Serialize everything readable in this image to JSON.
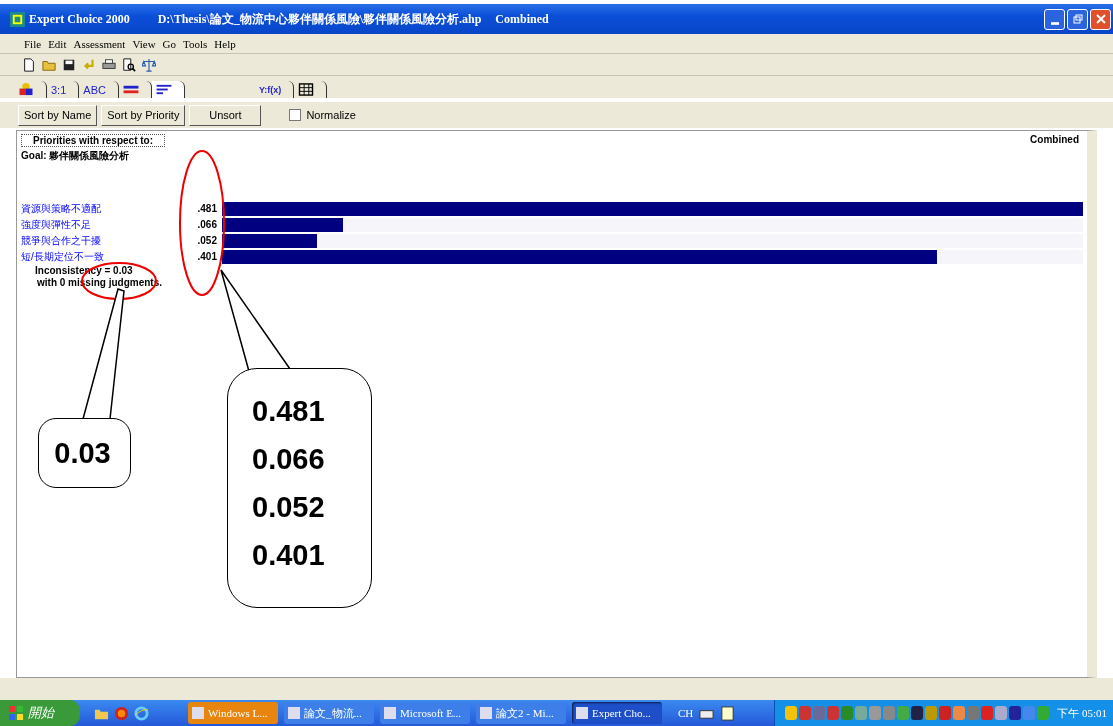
{
  "window": {
    "title": "Expert Choice 2000",
    "path": "D:\\Thesis\\論文_物流中心夥伴關係風險\\夥伴關係風險分析.ahp",
    "mode": "Combined"
  },
  "menu": [
    "File",
    "Edit",
    "Assessment",
    "View",
    "Go",
    "Tools",
    "Help"
  ],
  "tabs": [
    {
      "kind": "shapes",
      "selected": false
    },
    {
      "kind": "text",
      "label": "3:1",
      "selected": false
    },
    {
      "kind": "text",
      "label": "ABC",
      "selected": false
    },
    {
      "kind": "equal",
      "selected": false
    },
    {
      "kind": "sort",
      "selected": true
    },
    {
      "kind": "formula",
      "label": "Y:f(x)",
      "selected": false
    },
    {
      "kind": "grid",
      "selected": false
    }
  ],
  "buttons": [
    "Sort by Name",
    "Sort by Priority",
    "Unsort"
  ],
  "normalize": {
    "label": "Normalize",
    "checked": false
  },
  "header": {
    "caption": "Priorities with respect to:",
    "goal": "Goal: 夥伴關係風險分析",
    "right": "Combined"
  },
  "priorities": [
    {
      "name": "資源與策略不適配",
      "value": ".481",
      "level": 1.0
    },
    {
      "name": "強度與彈性不足",
      "value": ".066",
      "level": 0.14
    },
    {
      "name": "競爭與合作之干擾",
      "value": ".052",
      "level": 0.11
    },
    {
      "name": "短/長期定位不一致",
      "value": ".401",
      "level": 0.83
    }
  ],
  "inconsistency": "Inconsistency = 0.03",
  "missing": "with 0  missing judgments.",
  "callouts": [
    {
      "lines": [
        "0.03"
      ]
    },
    {
      "lines": [
        "0.481",
        "0.066",
        "0.052",
        "0.401"
      ]
    }
  ],
  "taskbar": {
    "start": "開始",
    "tasks": [
      {
        "label": "Windows L...",
        "selected": false,
        "color": "#e8850f"
      },
      {
        "label": "論文_物流...",
        "selected": false,
        "color": "#3d7ee8"
      },
      {
        "label": "Microsoft E...",
        "selected": false,
        "color": "#3d7ee8"
      },
      {
        "label": "論文2 - Mi...",
        "selected": false,
        "color": "#3d7ee8"
      },
      {
        "label": "Expert Cho...",
        "selected": true,
        "color": "#1e4fc9"
      }
    ],
    "lang": "CH",
    "clock": "下午 05:01"
  }
}
